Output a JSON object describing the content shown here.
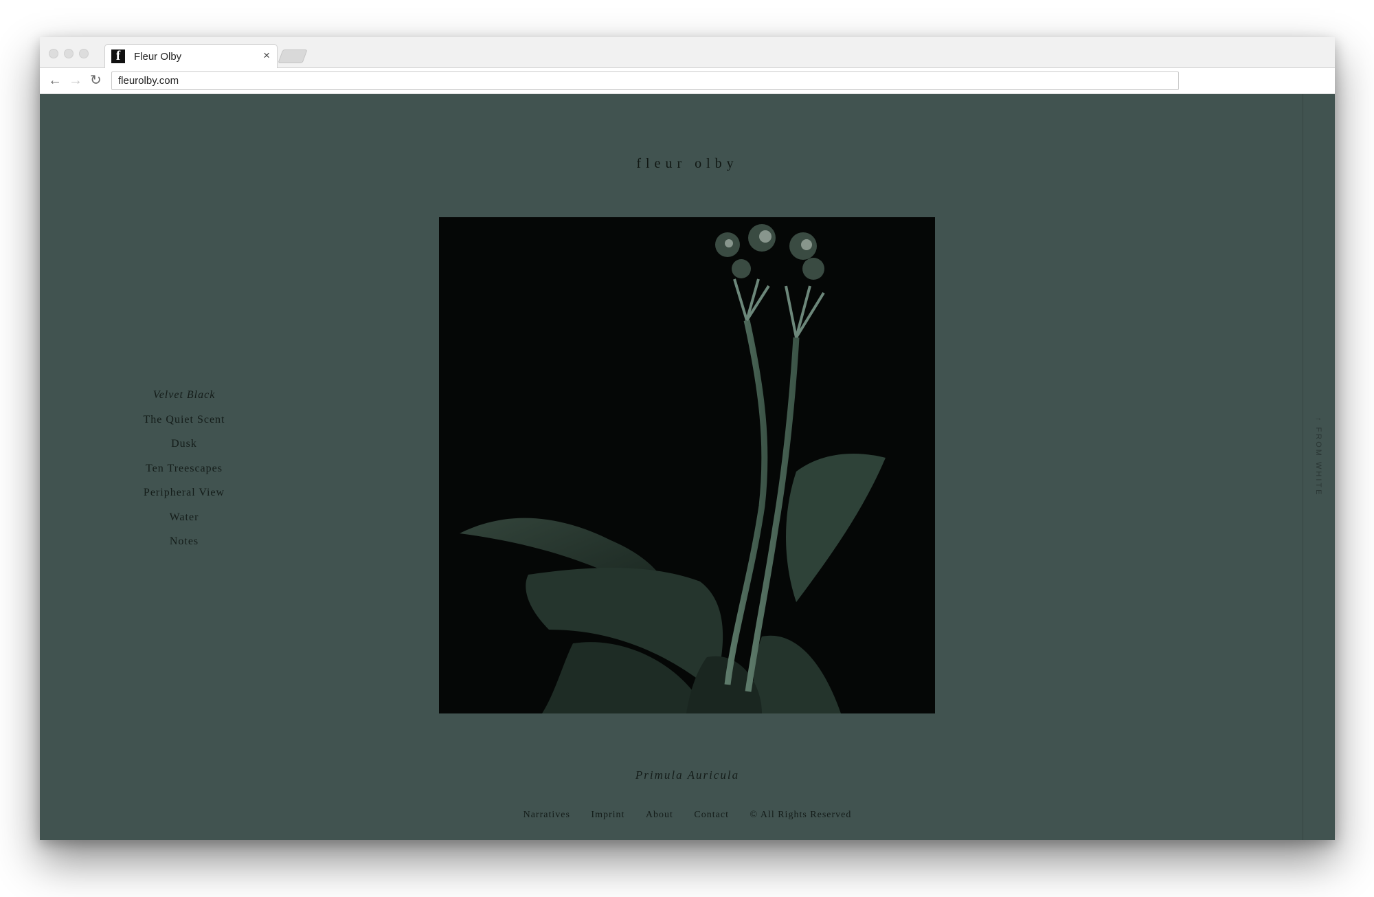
{
  "browser": {
    "tab": {
      "favicon": "f",
      "title": "Fleur Olby",
      "close": "×"
    },
    "url": "fleurolby.com",
    "nav_icons": {
      "back": "←",
      "forward": "→",
      "reload": "↻"
    }
  },
  "site": {
    "title": "fleur olby",
    "side_nav": [
      {
        "label": "Velvet Black",
        "active": true
      },
      {
        "label": "The Quiet Scent"
      },
      {
        "label": "Dusk"
      },
      {
        "label": "Ten Treescapes"
      },
      {
        "label": "Peripheral View"
      },
      {
        "label": "Water"
      },
      {
        "label": "Notes"
      }
    ],
    "rail_link": "↑ FROM WHITE",
    "photo": {
      "subject": "dark flower photograph"
    },
    "caption": "Primula Auricula",
    "footer": {
      "links": [
        "Narratives",
        "Imprint",
        "About",
        "Contact"
      ],
      "copyright": "© All Rights Reserved"
    }
  },
  "colors": {
    "page_bg": "#415350",
    "photo_bg": "#050706",
    "text": "#141c19"
  }
}
